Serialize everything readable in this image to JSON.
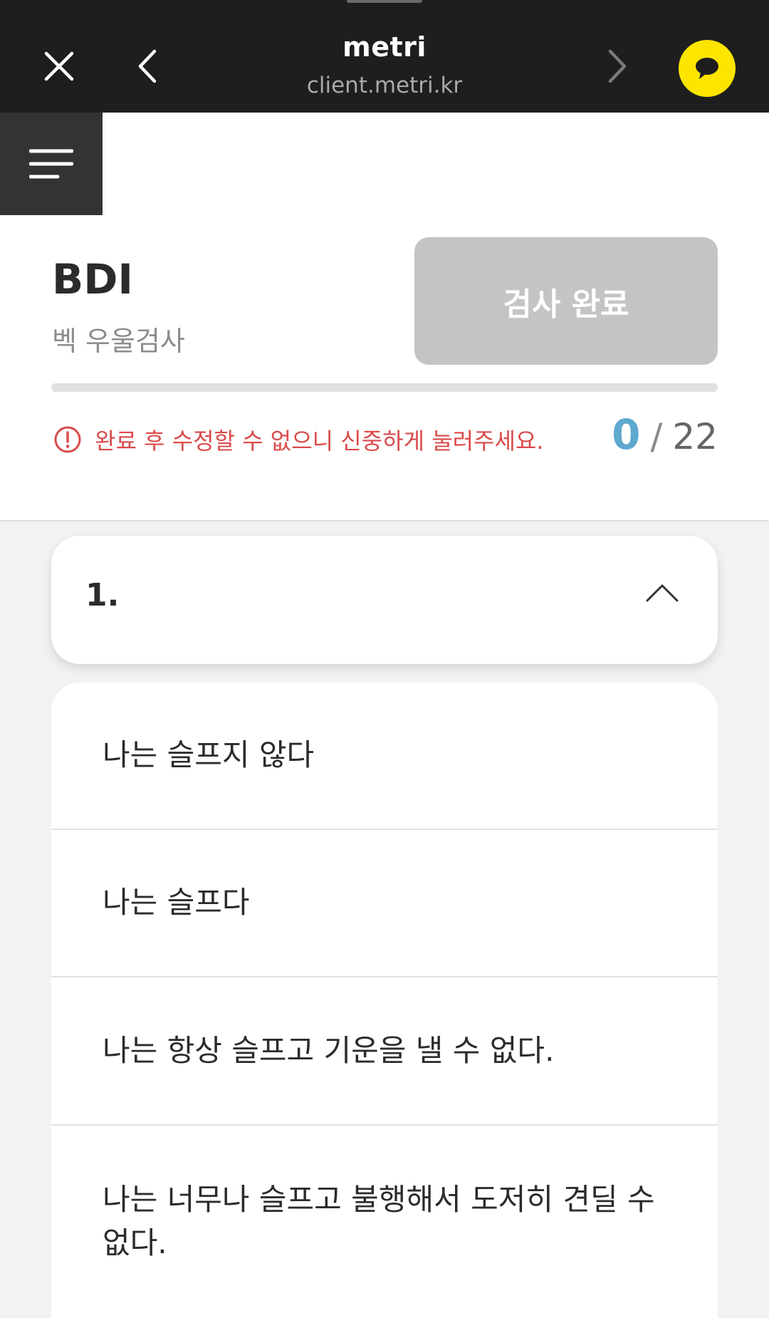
{
  "browser": {
    "site_title": "metri",
    "site_url": "client.metri.kr",
    "icons": {
      "close": "close-icon",
      "back": "chevron-left-icon",
      "forward": "chevron-right-icon",
      "chat": "kakao-chat-icon"
    }
  },
  "header": {
    "menu_icon": "hamburger-menu-icon",
    "test_code": "BDI",
    "test_name": "벡 우울검사",
    "complete_button_label": "검사 완료",
    "warning_text": "완료 후 수정할 수 없으니 신중하게 눌러주세요.",
    "progress": {
      "answered": "0",
      "separator": "/",
      "total": "22",
      "fraction": 0
    }
  },
  "question": {
    "number": "1.",
    "toggle_icon": "chevron-up-icon",
    "options": [
      "나는 슬프지 않다",
      "나는 슬프다",
      "나는 항상 슬프고 기운을 낼 수 없다.",
      "나는 너무나 슬프고 불행해서 도저히 견딜 수 없다."
    ]
  },
  "colors": {
    "topbar": "#1e1e1e",
    "kakao_yellow": "#fee500",
    "warning_red": "#d94a4a",
    "accent_blue": "#5ea9cf",
    "disabled_button": "#c4c4c4"
  }
}
